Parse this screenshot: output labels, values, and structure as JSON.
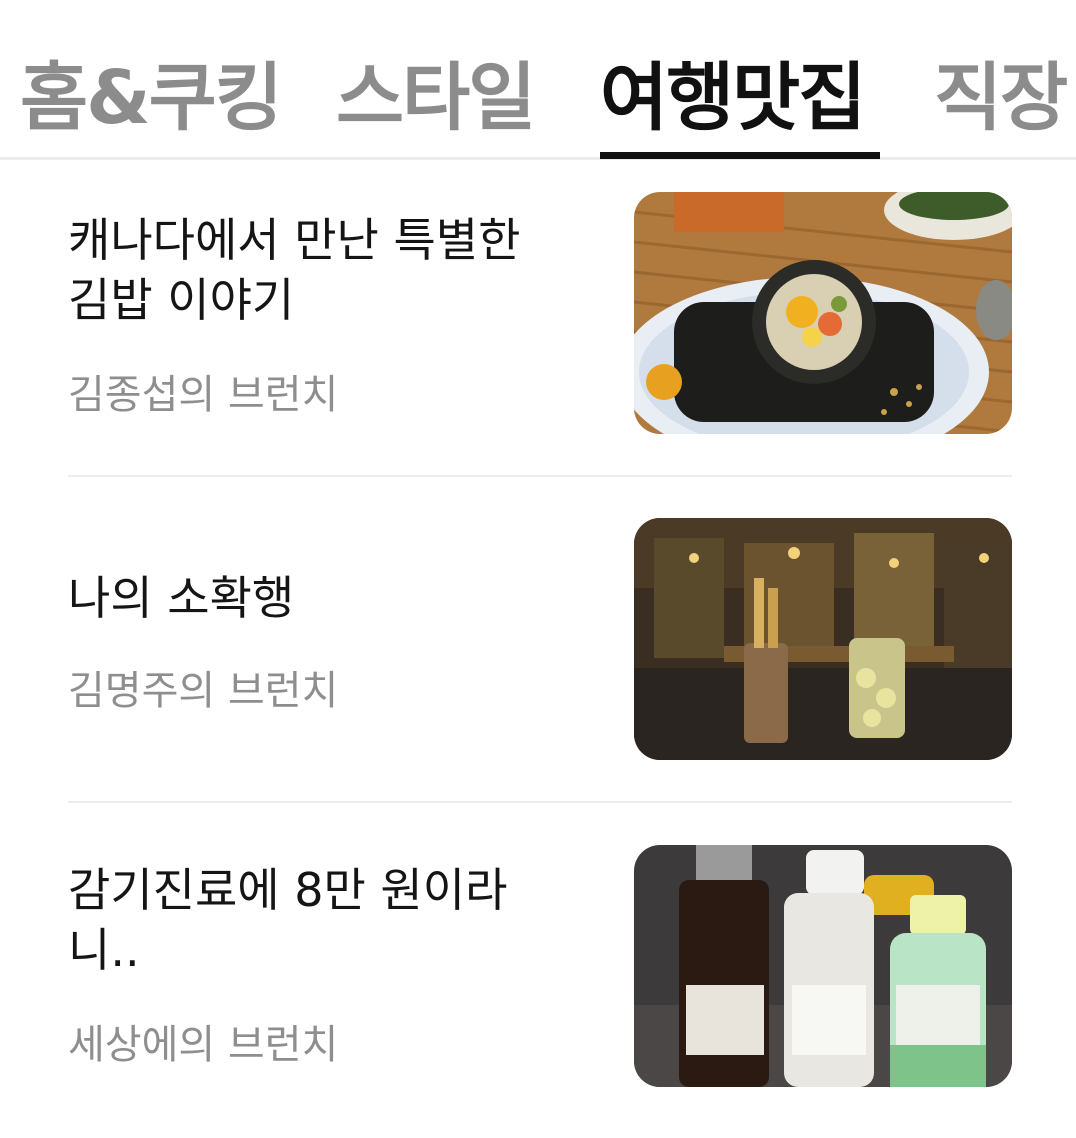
{
  "tabs": [
    {
      "label": "홈&쿠킹",
      "active": false
    },
    {
      "label": "스타일",
      "active": false
    },
    {
      "label": "여행맛집",
      "active": true
    },
    {
      "label": "직장",
      "active": false
    }
  ],
  "articles": [
    {
      "title_line1": "캐나다에서 만난 특별한",
      "title_line2": "김밥 이야기",
      "author": "김종섭의 브런치",
      "thumb_icon": "kimbap-photo"
    },
    {
      "title_line1": "나의 소확행",
      "title_line2": "",
      "author": "김명주의 브런치",
      "thumb_icon": "restaurant-bar-photo"
    },
    {
      "title_line1": "감기진료에 8만 원이라",
      "title_line2": "니..",
      "author": "세상에의 브런치",
      "thumb_icon": "medicine-bottles-photo"
    }
  ],
  "colors": {
    "active_tab": "#111111",
    "inactive_tab": "#8c8c8c",
    "author": "#8e8e8e"
  }
}
